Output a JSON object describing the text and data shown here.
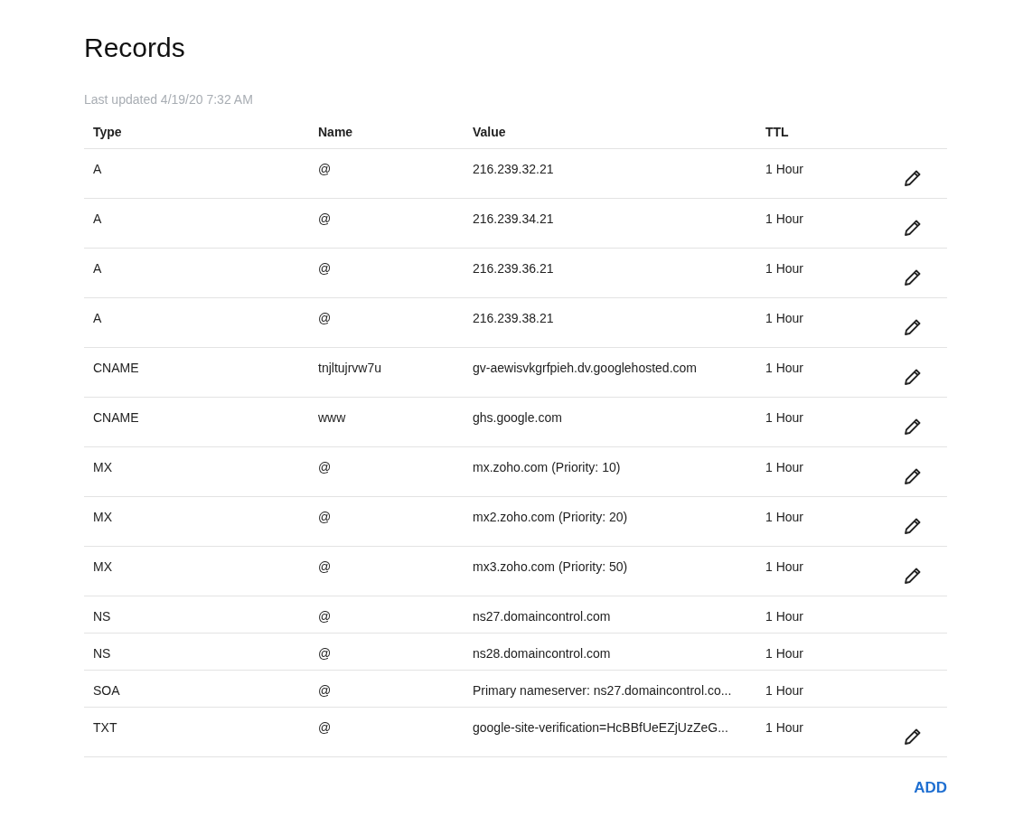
{
  "title": "Records",
  "last_updated": "Last updated 4/19/20 7:32 AM",
  "table": {
    "columns": [
      "Type",
      "Name",
      "Value",
      "TTL"
    ],
    "rows": [
      {
        "type": "A",
        "name": "@",
        "value": "216.239.32.21",
        "ttl": "1 Hour",
        "editable": true
      },
      {
        "type": "A",
        "name": "@",
        "value": "216.239.34.21",
        "ttl": "1 Hour",
        "editable": true
      },
      {
        "type": "A",
        "name": "@",
        "value": "216.239.36.21",
        "ttl": "1 Hour",
        "editable": true
      },
      {
        "type": "A",
        "name": "@",
        "value": "216.239.38.21",
        "ttl": "1 Hour",
        "editable": true
      },
      {
        "type": "CNAME",
        "name": "tnjltujrvw7u",
        "value": "gv-aewisvkgrfpieh.dv.googlehosted.com",
        "ttl": "1 Hour",
        "editable": true
      },
      {
        "type": "CNAME",
        "name": "www",
        "value": "ghs.google.com",
        "ttl": "1 Hour",
        "editable": true
      },
      {
        "type": "MX",
        "name": "@",
        "value": "mx.zoho.com (Priority: 10)",
        "ttl": "1 Hour",
        "editable": true
      },
      {
        "type": "MX",
        "name": "@",
        "value": "mx2.zoho.com (Priority: 20)",
        "ttl": "1 Hour",
        "editable": true
      },
      {
        "type": "MX",
        "name": "@",
        "value": "mx3.zoho.com (Priority: 50)",
        "ttl": "1 Hour",
        "editable": true
      },
      {
        "type": "NS",
        "name": "@",
        "value": "ns27.domaincontrol.com",
        "ttl": "1 Hour",
        "editable": false
      },
      {
        "type": "NS",
        "name": "@",
        "value": "ns28.domaincontrol.com",
        "ttl": "1 Hour",
        "editable": false
      },
      {
        "type": "SOA",
        "name": "@",
        "value": "Primary nameserver: ns27.domaincontrol.co...",
        "ttl": "1 Hour",
        "editable": false
      },
      {
        "type": "TXT",
        "name": "@",
        "value": "google-site-verification=HcBBfUeEZjUzZeG...",
        "ttl": "1 Hour",
        "editable": true
      }
    ]
  },
  "add_button": "ADD"
}
